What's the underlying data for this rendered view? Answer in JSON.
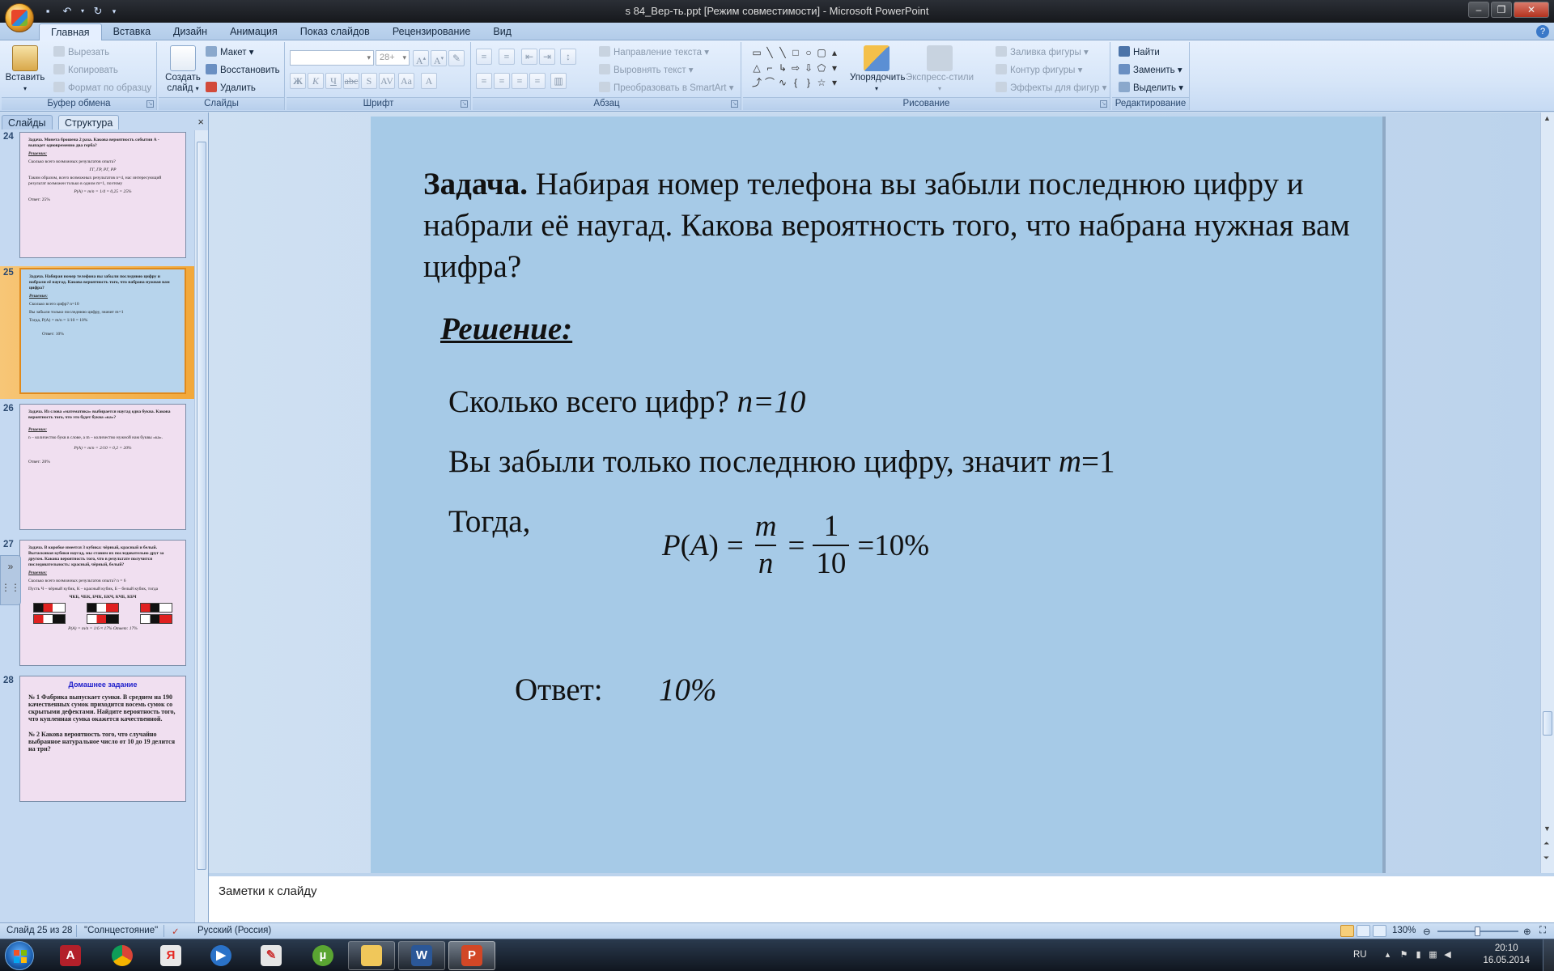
{
  "window": {
    "title": "s 84_Вер-ть.ppt [Режим совместимости] - Microsoft PowerPoint"
  },
  "ribbon": {
    "tabs": [
      "Главная",
      "Вставка",
      "Дизайн",
      "Анимация",
      "Показ слайдов",
      "Рецензирование",
      "Вид"
    ],
    "active_tab": "Главная",
    "clipboard": {
      "label": "Буфер обмена",
      "paste": "Вставить",
      "cut": "Вырезать",
      "copy": "Копировать",
      "format_painter": "Формат по образцу"
    },
    "slides": {
      "label": "Слайды",
      "new_slide": "Создать слайд",
      "layout": "Макет",
      "reset": "Восстановить",
      "delete": "Удалить"
    },
    "font": {
      "label": "Шрифт",
      "font_name": "",
      "font_size": "28+"
    },
    "paragraph": {
      "label": "Абзац",
      "text_direction": "Направление текста",
      "align_text": "Выровнять текст",
      "smartart": "Преобразовать в SmartArt"
    },
    "drawing": {
      "label": "Рисование",
      "arrange": "Упорядочить",
      "quick_styles": "Экспресс-стили",
      "shape_fill": "Заливка фигуры",
      "shape_outline": "Контур фигуры",
      "shape_effects": "Эффекты для фигур"
    },
    "editing": {
      "label": "Редактирование",
      "find": "Найти",
      "replace": "Заменить",
      "select": "Выделить"
    }
  },
  "panel": {
    "tabs": [
      "Слайды",
      "Структура"
    ],
    "close": "×"
  },
  "thumbnails": [
    {
      "number": "24",
      "lines": [
        "Задача. Монета брошена 2 раза. Какова вероятность события А - выпадет одновременно два герба?",
        "Решение:",
        "Сколько всего возможных результатов опыта?",
        "ГГ,    ГР,    РГ,    РР",
        "Таким образом, всего возможных результатов n=4, нас интересующий результат возможен только в одном m=1, поэтому",
        "P(A) = m/n = 1/4 = 0,25 = 25%",
        "Ответ:    25%"
      ]
    },
    {
      "number": "25",
      "lines": [
        "Задача. Набирая номер телефона вы забыли последнюю цифру и набрали её наугад. Какова вероятность того, что набрана нужная вам цифра?",
        "Решение:",
        "Сколько всего цифр? n=10",
        "Вы забыли только последнюю цифру, значит m=1",
        "Тогда,          P(A) = m/n = 1/10 = 10%",
        "Ответ:    10%"
      ]
    },
    {
      "number": "26",
      "lines": [
        "Задача. Из слова «математика» выбирается наугад одна буква. Какова вероятность того, что это будет буква «ка»?",
        "Решение:",
        "n – количество букв в слове, а m – количество нужной нам буквы «ка».",
        "P(A) = m/n = 2/10 = 0,2 = 20%",
        "Ответ:    20%"
      ]
    },
    {
      "number": "27",
      "lines": [
        "Задача. В коробке имеется 3 кубика: чёрный, красный и белый. Вытаскивая кубики наугад, мы ставим их последовательно друг за другом. Какова вероятность того, что в результате получится последовательность: красный, чёрный, белый?",
        "Решение:",
        "Сколько всего возможных результатов опыта?    n = 6",
        "Пусть Ч – чёрный кубик, К – красный кубик, Б – белый кубик, тогда",
        "ЧКБ, ЧБК, БЧК, БКЧ, КЧБ, КБЧ",
        "P(A) = m/n = 1/6 ≈ 17%          Ответ: 17%"
      ]
    },
    {
      "number": "28",
      "lines": [
        "Домашнее задание",
        "№ 1  Фабрика выпускает сумки. В среднем на 190 качественных сумок приходится восемь сумок со скрытыми дефектами. Найдите вероятность того, что купленная сумка окажется качественной.",
        "№ 2  Какова вероятность того, что случайно выбранное натуральное число от 10 до 19 делится на три?"
      ]
    }
  ],
  "slide": {
    "task_bold": "Задача.",
    "task_text": " Набирая номер телефона вы забыли последнюю цифру и набрали её наугад. Какова вероятность того, что набрана нужная вам цифра?",
    "solution_heading": "Решение:",
    "line1_text": "Сколько всего цифр? ",
    "line1_math": "n=10",
    "line2_text": "Вы забыли только последнюю цифру, значит ",
    "line2_var": "m",
    "line2_rest": "=1",
    "then": "Тогда,",
    "formula": {
      "lhs_p": "P",
      "lhs_open": "(",
      "lhs_a": "A",
      "lhs_close": ")",
      "eq": "=",
      "frac1_num": "m",
      "frac1_den": "n",
      "frac2_num": "1",
      "frac2_den": "10",
      "result": "=10%"
    },
    "answer_label": "Ответ:",
    "answer_value": "10%"
  },
  "notes": {
    "placeholder": "Заметки к слайду"
  },
  "status": {
    "slide_position": "Слайд 25 из 28",
    "theme": "\"Солнцестояние\"",
    "language": "Русский (Россия)",
    "zoom": "130%"
  },
  "taskbar": {
    "apps": [
      "Adobe Acrobat",
      "Google Chrome",
      "Яндекс Браузер",
      "Media Player",
      "Paint",
      "uTorrent",
      "Проводник",
      "Microsoft Word",
      "Microsoft PowerPoint"
    ],
    "language": "RU",
    "time": "20:10",
    "date": "16.05.2014"
  },
  "colors": {
    "slide_background": "#a6cae7",
    "selected_thumb": "#f2a83a",
    "ribbon": "#d6e5f8"
  }
}
